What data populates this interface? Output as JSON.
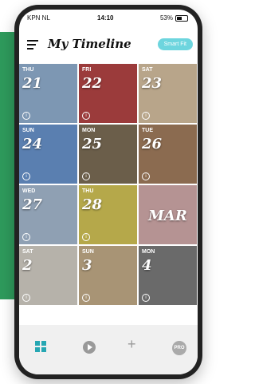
{
  "status": {
    "carrier": "KPN NL",
    "time": "14:10",
    "battery": "53%"
  },
  "header": {
    "title": "My Timeline",
    "smart_label": "Smart Fit"
  },
  "cells": [
    {
      "day": "THU",
      "num": "21",
      "color": "#7d97b3"
    },
    {
      "day": "FRI",
      "num": "22",
      "color": "#9b3b3b"
    },
    {
      "day": "SAT",
      "num": "23",
      "color": "#b8a58a"
    },
    {
      "day": "SUN",
      "num": "24",
      "color": "#5a7fb0"
    },
    {
      "day": "MON",
      "num": "25",
      "color": "#6b5e4a"
    },
    {
      "day": "TUE",
      "num": "26",
      "color": "#8b6b50"
    },
    {
      "day": "WED",
      "num": "27",
      "color": "#8fa0b3"
    },
    {
      "day": "THU",
      "num": "28",
      "color": "#b5a84a"
    },
    {
      "day": "",
      "num": "MAR",
      "color": "#b59393"
    },
    {
      "day": "SAT",
      "num": "2",
      "color": "#b6b2aa"
    },
    {
      "day": "SUN",
      "num": "3",
      "color": "#a89475"
    },
    {
      "day": "MON",
      "num": "4",
      "color": "#6a6a6a"
    }
  ],
  "footer_labels": {
    "pro": "PRO"
  }
}
